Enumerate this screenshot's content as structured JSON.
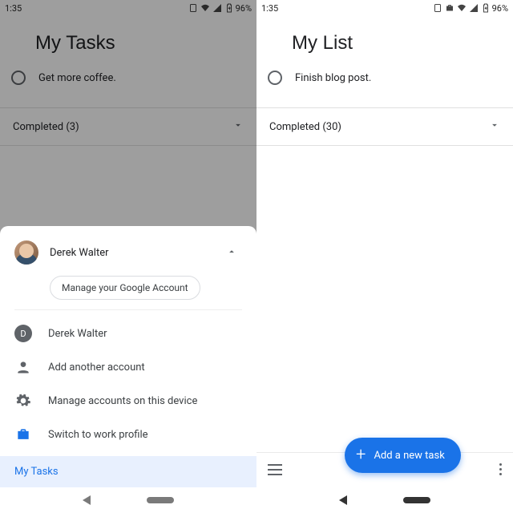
{
  "left": {
    "status": {
      "time": "1:35",
      "battery": "96%"
    },
    "title": "My Tasks",
    "task": "Get more coffee.",
    "completed_label": "Completed (3)",
    "sheet": {
      "primary_name": "Derek Walter",
      "manage_button": "Manage your Google Account",
      "secondary_name": "Derek Walter",
      "secondary_initial": "D",
      "add_account": "Add another account",
      "manage_device": "Manage accounts on this device",
      "switch_work": "Switch to work profile",
      "footer_list": "My Tasks"
    }
  },
  "right": {
    "status": {
      "time": "1:35",
      "battery": "96%"
    },
    "title": "My List",
    "task": "Finish blog post.",
    "completed_label": "Completed (30)",
    "fab_label": "Add a new task"
  }
}
